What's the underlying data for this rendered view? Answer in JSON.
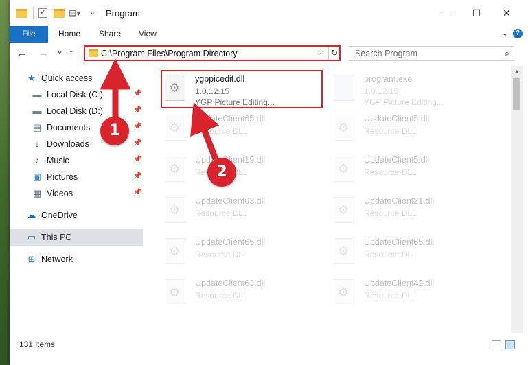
{
  "window": {
    "title": "Program",
    "controls": {
      "minimize": "—",
      "maximize": "☐",
      "close": "✕"
    }
  },
  "ribbon": {
    "tabs": [
      "File",
      "Home",
      "Share",
      "View"
    ],
    "help": "?"
  },
  "navigation": {
    "back": "←",
    "forward": "→",
    "recent": "⌄",
    "up": "↑",
    "address": "C:\\Program Files\\Program Directory",
    "search_placeholder": "Search Program"
  },
  "sidebar": {
    "items": [
      {
        "label": "Quick access",
        "icon": "star-icon",
        "pinned": false
      },
      {
        "label": "Local Disk (C:)",
        "icon": "drive-icon",
        "pinned": true
      },
      {
        "label": "Local Disk (D:)",
        "icon": "drive-icon",
        "pinned": true
      },
      {
        "label": "Documents",
        "icon": "documents-icon",
        "pinned": true
      },
      {
        "label": "Downloads",
        "icon": "downloads-icon",
        "pinned": true
      },
      {
        "label": "Music",
        "icon": "music-icon",
        "pinned": true
      },
      {
        "label": "Pictures",
        "icon": "pictures-icon",
        "pinned": true
      },
      {
        "label": "Videos",
        "icon": "videos-icon",
        "pinned": true
      },
      {
        "label": "OneDrive",
        "icon": "cloud-icon",
        "pinned": false
      },
      {
        "label": "This PC",
        "icon": "computer-icon",
        "pinned": false,
        "selected": true
      },
      {
        "label": "Network",
        "icon": "network-icon",
        "pinned": false
      }
    ]
  },
  "files": [
    {
      "name": "ygppicedit.dll",
      "line2": "1.0.12.15",
      "line3": "YGP Picture Editing...",
      "highlighted": true
    },
    {
      "name": "program.exe",
      "line2": "1.0.12.15",
      "line3": "YGP Picture Editing...",
      "faded": true
    },
    {
      "name": "UpdateClient65.dll",
      "line2": "Resource DLL",
      "faded": true
    },
    {
      "name": "UpdateClient5.dll",
      "line2": "Resource DLL",
      "faded": true
    },
    {
      "name": "UpdateClient19.dll",
      "line2": "Resource DLL",
      "faded": true
    },
    {
      "name": "UpdateClient5.dll",
      "line2": "Resource DLL",
      "faded": true
    },
    {
      "name": "UpdateClient63.dll",
      "line2": "Resource DLL",
      "faded": true
    },
    {
      "name": "UpdateClient21.dll",
      "line2": "Resource DLL",
      "faded": true
    },
    {
      "name": "UpdateClient65.dll",
      "line2": "Resource DLL",
      "faded": true
    },
    {
      "name": "UpdateClient65.dll",
      "line2": "Resource DLL",
      "faded": true
    },
    {
      "name": "UpdateClient63.dll",
      "line2": "Resource DLL",
      "faded": true
    },
    {
      "name": "UpdateClient42.dll",
      "line2": "Resource DLL",
      "faded": true
    }
  ],
  "status": {
    "item_count": "131 items"
  },
  "annotations": {
    "step1": "1",
    "step2": "2",
    "color": "#d9232d"
  }
}
